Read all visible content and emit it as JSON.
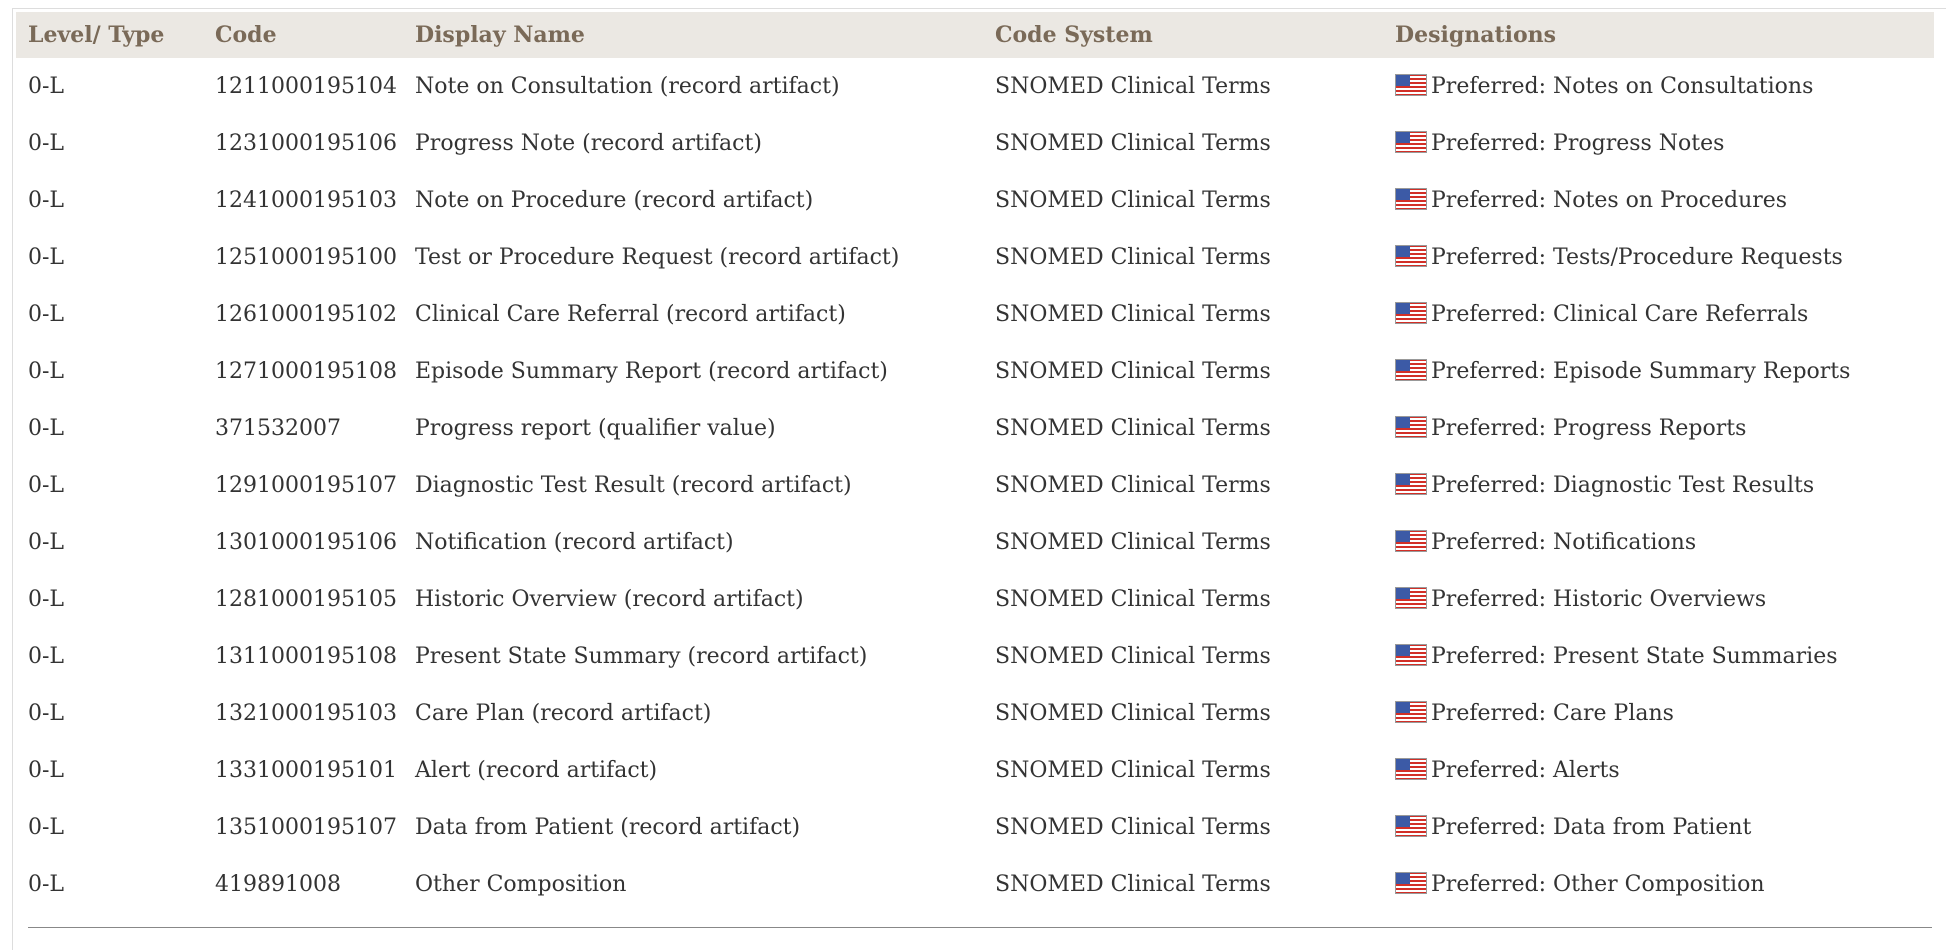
{
  "table": {
    "headers": {
      "level": "Level/ Type",
      "code": "Code",
      "display": "Display Name",
      "system": "Code System",
      "designations": "Designations"
    },
    "rows": [
      {
        "level": "0-L",
        "code": "1211000195104",
        "display": "Note on Consultation (record artifact)",
        "system": "SNOMED Clinical Terms",
        "designation": "Preferred: Notes on Consultations"
      },
      {
        "level": "0-L",
        "code": "1231000195106",
        "display": "Progress Note (record artifact)",
        "system": "SNOMED Clinical Terms",
        "designation": "Preferred: Progress Notes"
      },
      {
        "level": "0-L",
        "code": "1241000195103",
        "display": "Note on Procedure (record artifact)",
        "system": "SNOMED Clinical Terms",
        "designation": "Preferred: Notes on Procedures"
      },
      {
        "level": "0-L",
        "code": "1251000195100",
        "display": "Test or Procedure Request (record artifact)",
        "system": "SNOMED Clinical Terms",
        "designation": "Preferred: Tests/Procedure Requests"
      },
      {
        "level": "0-L",
        "code": "1261000195102",
        "display": "Clinical Care Referral (record artifact)",
        "system": "SNOMED Clinical Terms",
        "designation": "Preferred: Clinical Care Referrals"
      },
      {
        "level": "0-L",
        "code": "1271000195108",
        "display": "Episode Summary Report (record artifact)",
        "system": "SNOMED Clinical Terms",
        "designation": "Preferred: Episode Summary Reports"
      },
      {
        "level": "0-L",
        "code": "371532007",
        "display": "Progress report (qualifier value)",
        "system": "SNOMED Clinical Terms",
        "designation": "Preferred: Progress Reports"
      },
      {
        "level": "0-L",
        "code": "1291000195107",
        "display": "Diagnostic Test Result (record artifact)",
        "system": "SNOMED Clinical Terms",
        "designation": "Preferred: Diagnostic Test Results"
      },
      {
        "level": "0-L",
        "code": "1301000195106",
        "display": "Notification (record artifact)",
        "system": "SNOMED Clinical Terms",
        "designation": "Preferred: Notifications"
      },
      {
        "level": "0-L",
        "code": "1281000195105",
        "display": "Historic Overview (record artifact)",
        "system": "SNOMED Clinical Terms",
        "designation": "Preferred: Historic Overviews"
      },
      {
        "level": "0-L",
        "code": "1311000195108",
        "display": "Present State Summary (record artifact)",
        "system": "SNOMED Clinical Terms",
        "designation": "Preferred: Present State Summaries"
      },
      {
        "level": "0-L",
        "code": "1321000195103",
        "display": "Care Plan (record artifact)",
        "system": "SNOMED Clinical Terms",
        "designation": "Preferred: Care Plans"
      },
      {
        "level": "0-L",
        "code": "1331000195101",
        "display": "Alert (record artifact)",
        "system": "SNOMED Clinical Terms",
        "designation": "Preferred: Alerts"
      },
      {
        "level": "0-L",
        "code": "1351000195107",
        "display": "Data from Patient (record artifact)",
        "system": "SNOMED Clinical Terms",
        "designation": "Preferred: Data from Patient"
      },
      {
        "level": "0-L",
        "code": "419891008",
        "display": "Other Composition",
        "system": "SNOMED Clinical Terms",
        "designation": "Preferred: Other Composition"
      }
    ],
    "designation_icon": "us-flag-icon"
  },
  "colors": {
    "header_background": "#ebe8e3",
    "header_text": "#7a6a58",
    "body_text": "#333333",
    "rule": "#888888"
  }
}
